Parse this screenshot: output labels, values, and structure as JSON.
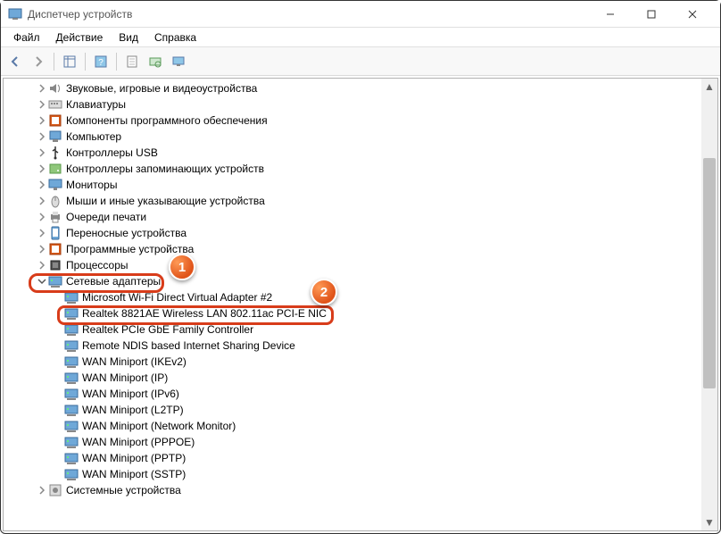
{
  "window": {
    "title": "Диспетчер устройств"
  },
  "menu": {
    "file": "Файл",
    "action": "Действие",
    "view": "Вид",
    "help": "Справка"
  },
  "tree": {
    "nodes": [
      {
        "label": "Звуковые, игровые и видеоустройства",
        "depth": 2,
        "icon": "speaker"
      },
      {
        "label": "Клавиатуры",
        "depth": 2,
        "icon": "keyboard"
      },
      {
        "label": "Компоненты программного обеспечения",
        "depth": 2,
        "icon": "software"
      },
      {
        "label": "Компьютер",
        "depth": 2,
        "icon": "computer"
      },
      {
        "label": "Контроллеры USB",
        "depth": 2,
        "icon": "usb"
      },
      {
        "label": "Контроллеры запоминающих устройств",
        "depth": 2,
        "icon": "storage"
      },
      {
        "label": "Мониторы",
        "depth": 2,
        "icon": "monitor"
      },
      {
        "label": "Мыши и иные указывающие устройства",
        "depth": 2,
        "icon": "mouse"
      },
      {
        "label": "Очереди печати",
        "depth": 2,
        "icon": "printer"
      },
      {
        "label": "Переносные устройства",
        "depth": 2,
        "icon": "portable"
      },
      {
        "label": "Программные устройства",
        "depth": 2,
        "icon": "software"
      },
      {
        "label": "Процессоры",
        "depth": 2,
        "icon": "cpu"
      },
      {
        "label": "Сетевые адаптеры",
        "depth": 2,
        "icon": "network",
        "expanded": true
      },
      {
        "label": "Microsoft Wi-Fi Direct Virtual Adapter #2",
        "depth": 3,
        "icon": "nic"
      },
      {
        "label": "Realtek 8821AE Wireless LAN 802.11ac PCI-E NIC",
        "depth": 3,
        "icon": "nic"
      },
      {
        "label": "Realtek PCIe GbE Family Controller",
        "depth": 3,
        "icon": "nic"
      },
      {
        "label": "Remote NDIS based Internet Sharing Device",
        "depth": 3,
        "icon": "nic"
      },
      {
        "label": "WAN Miniport (IKEv2)",
        "depth": 3,
        "icon": "nic"
      },
      {
        "label": "WAN Miniport (IP)",
        "depth": 3,
        "icon": "nic"
      },
      {
        "label": "WAN Miniport (IPv6)",
        "depth": 3,
        "icon": "nic"
      },
      {
        "label": "WAN Miniport (L2TP)",
        "depth": 3,
        "icon": "nic"
      },
      {
        "label": "WAN Miniport (Network Monitor)",
        "depth": 3,
        "icon": "nic"
      },
      {
        "label": "WAN Miniport (PPPOE)",
        "depth": 3,
        "icon": "nic"
      },
      {
        "label": "WAN Miniport (PPTP)",
        "depth": 3,
        "icon": "nic"
      },
      {
        "label": "WAN Miniport (SSTP)",
        "depth": 3,
        "icon": "nic"
      },
      {
        "label": "Системные устройства",
        "depth": 2,
        "icon": "system"
      }
    ]
  },
  "callouts": {
    "one": "1",
    "two": "2"
  }
}
